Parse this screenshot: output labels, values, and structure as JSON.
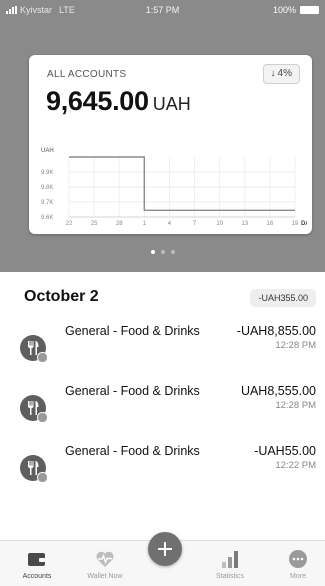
{
  "status_bar": {
    "carrier": "Kyivstar",
    "network": "LTE",
    "time": "1:57 PM",
    "battery": "100%"
  },
  "balance_card": {
    "title": "ALL ACCOUNTS",
    "change_arrow": "↓",
    "change_value": "4%",
    "balance_value": "9,645.00",
    "balance_currency": "UAH",
    "page_indicator": {
      "count": 3,
      "active": 0
    }
  },
  "chart_data": {
    "type": "line",
    "ylabel": "UAH",
    "xlabel": "DAY",
    "x_ticks": [
      "22",
      "25",
      "28",
      "1",
      "4",
      "7",
      "10",
      "13",
      "16",
      "19"
    ],
    "y_ticks": [
      "9.9K",
      "9.8K",
      "9.7K",
      "9.6K"
    ],
    "ylim": [
      9.6,
      10.0
    ],
    "series": [
      {
        "x": [
          "22",
          "25",
          "28",
          "1",
          "1",
          "4",
          "7",
          "10",
          "13",
          "16",
          "19"
        ],
        "values": [
          10.0,
          10.0,
          10.0,
          10.0,
          9.645,
          9.645,
          9.645,
          9.645,
          9.645,
          9.645,
          9.645
        ]
      }
    ],
    "grid": true
  },
  "day_section": {
    "title": "October 2",
    "total": "-UAH355.00"
  },
  "transactions": [
    {
      "title": "General - Food & Drinks",
      "amount": "-UAH8,855.00",
      "time": "12:28 PM",
      "icon": "fork-knife-icon"
    },
    {
      "title": "General - Food & Drinks",
      "amount": "UAH8,555.00",
      "time": "12:28 PM",
      "icon": "fork-knife-icon"
    },
    {
      "title": "General - Food & Drinks",
      "amount": "-UAH55.00",
      "time": "12:22 PM",
      "icon": "fork-knife-icon"
    }
  ],
  "tabbar": {
    "accounts": "Accounts",
    "wallet_now": "Wallet Now",
    "statistics": "Statistics",
    "more": "More"
  },
  "colors": {
    "header_bg": "#8a8a8a",
    "avatar": "#5f5f5f",
    "fab": "#707070"
  }
}
